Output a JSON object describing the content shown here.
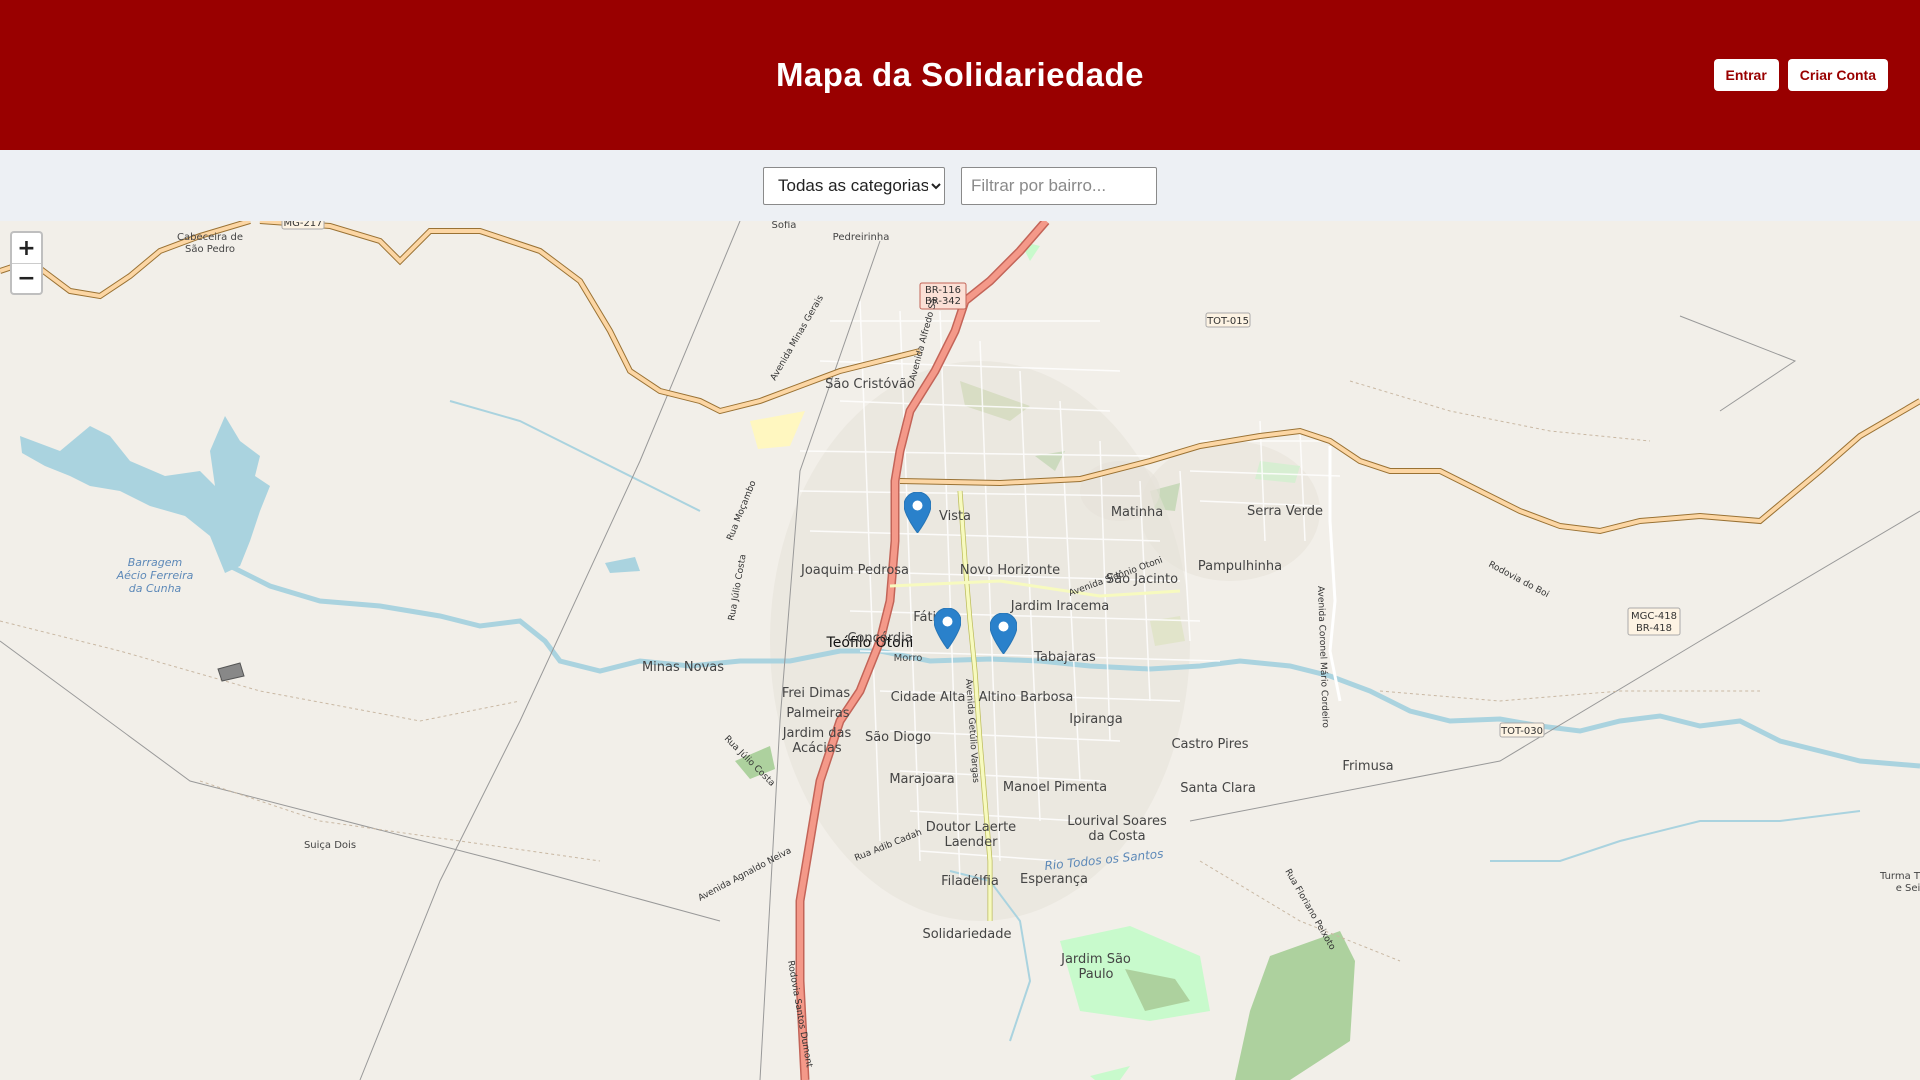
{
  "header": {
    "title": "Mapa da Solidariedade",
    "login_label": "Entrar",
    "signup_label": "Criar Conta"
  },
  "filters": {
    "category_selected": "Todas as categorias",
    "neighborhood_placeholder": "Filtrar por bairro..."
  },
  "map": {
    "zoom_in": "+",
    "zoom_out": "−",
    "markers_count": 3,
    "labels": {
      "city": "Teófilo Otoni",
      "sao_cristovao": "São Cristóvão",
      "vista": "Vista",
      "joaquim_pedrosa": "Joaquim Pedrosa",
      "novo_horizonte": "Novo Horizonte",
      "matinha": "Matinha",
      "serra_verde": "Serra Verde",
      "pampulhinha": "Pampulhinha",
      "sao_jacinto": "São Jacinto",
      "jardim_iracema": "Jardim Iracema",
      "fatima": "Fátima",
      "concordia": "Concórdia",
      "morro": "Morro",
      "tabajaras": "Tabajaras",
      "minas_novas": "Minas Novas",
      "frei_dimas": "Frei Dimas",
      "palmeiras": "Palmeiras",
      "cidade_alta": "Cidade Alta",
      "altino_barbosa": "Altino Barbosa",
      "ipiranga": "Ipiranga",
      "jardim_das_acacias_1": "Jardim das",
      "jardim_das_acacias_2": "Acácias",
      "sao_diogo": "São Diogo",
      "castro_pires": "Castro Pires",
      "frimusa": "Frimusa",
      "marajoara": "Marajoara",
      "manoel_pimenta": "Manoel Pimenta",
      "santa_clara": "Santa Clara",
      "doutor_laerte_1": "Doutor Laerte",
      "doutor_laerte_2": "Laender",
      "lourival_1": "Lourival Soares",
      "lourival_2": "da Costa",
      "filadelfia": "Filadélfia",
      "esperanca": "Esperança",
      "solidariedade": "Solidariedade",
      "jardim_sao_paulo_1": "Jardim São",
      "jardim_sao_paulo_2": "Paulo",
      "suica_dois": "Suiça Dois",
      "cabeceira_1": "Cabeceira de",
      "cabeceira_2": "São Pedro",
      "sofia": "Sofia",
      "pedreirinha": "Pedreirinha",
      "barragem_1": "Barragem",
      "barragem_2": "Aécio Ferreira",
      "barragem_3": "da Cunha",
      "rio_todos_santos": "Rio Todos os Santos",
      "turma_1": "Turma T",
      "turma_2": "e Sei",
      "br116": "BR-116",
      "br342": "BR-342",
      "mg217": "MG-217",
      "tot015": "TOT-015",
      "tot030": "TOT-030",
      "mgc418": "MGC-418",
      "br418": "BR-418",
      "av_minas_gerais": "Avenida Minas Gerais",
      "av_alfredo_sa": "Avenida Alfredo Sá",
      "rua_mocambo": "Rua Moçambo",
      "rua_julio_costa": "Rua Júlio Costa",
      "av_sidonio_otoni": "Avenida Sidônio Otoni",
      "rodovia_do_boi": "Rodovia do Boi",
      "av_cel_mario_cordeiro": "Avenida Coronel Mário Cordeiro",
      "av_getulio_vargas": "Avenida Getúlio Vargas",
      "rua_julio_costa_2": "Rua Júlio Costa",
      "av_agnaldo_neiva": "Avenida Agnaldo Neiva",
      "rua_adib_cadah": "Rua Adib Cadah",
      "rua_floriano_peixoto": "Rua Floriano Peixoto",
      "rodovia_santos_dumont": "Rodovia Santos Dumont"
    }
  }
}
